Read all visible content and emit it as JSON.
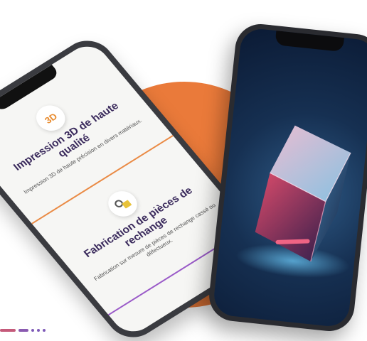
{
  "edge_text": "é",
  "left_phone": {
    "cards": [
      {
        "icon": "3D",
        "title": "Impression 3D de haute qualité",
        "desc": "Impression 3D de haute précision en divers matériaux."
      },
      {
        "icon": "",
        "title": "Fabrication de pièces de rechange",
        "desc": "Fabrication sur mesure de pièces de rechange cassé ou défectueux."
      }
    ]
  },
  "colors": {
    "accent_orange": "#ea7a3a",
    "title_purple": "#3a2a5c",
    "divider_purple": "#9a5ac8"
  }
}
